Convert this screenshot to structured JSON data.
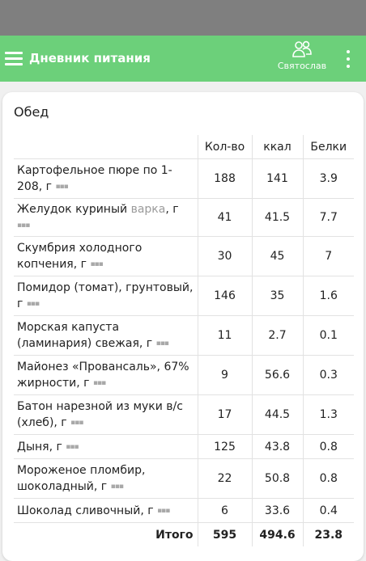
{
  "app": {
    "title": "Дневник питания",
    "user_name": "Святослав",
    "accent_color": "#6cd07a",
    "icons": {
      "menu": "hamburger-icon",
      "user": "people-icon",
      "more": "vertical-dots-icon"
    }
  },
  "meal": {
    "title": "Обед",
    "columns": [
      "Кол-во",
      "ккал",
      "Белки"
    ],
    "rows": [
      {
        "name": "Картофельное пюре по 1-208, г",
        "brand": "",
        "qty": "188",
        "kcal": "141",
        "protein": "3.9"
      },
      {
        "name": "Желудок куриный",
        "brand": "варка",
        "suffix": ", г",
        "qty": "41",
        "kcal": "41.5",
        "protein": "7.7"
      },
      {
        "name": "Скумбрия холодного копчения, г",
        "brand": "",
        "qty": "30",
        "kcal": "45",
        "protein": "7"
      },
      {
        "name": "Помидор (томат), грунтовый, г",
        "brand": "",
        "qty": "146",
        "kcal": "35",
        "protein": "1.6"
      },
      {
        "name": "Морская капуста (ламинария) свежая, г",
        "brand": "",
        "qty": "11",
        "kcal": "2.7",
        "protein": "0.1"
      },
      {
        "name": "Майонез «Провансаль», 67% жирности, г",
        "brand": "",
        "qty": "9",
        "kcal": "56.6",
        "protein": "0.3"
      },
      {
        "name": "Батон нарезной из муки в/с (хлеб), г",
        "brand": "",
        "qty": "17",
        "kcal": "44.5",
        "protein": "1.3"
      },
      {
        "name": "Дыня, г",
        "brand": "",
        "qty": "125",
        "kcal": "43.8",
        "protein": "0.8"
      },
      {
        "name": "Мороженое пломбир, шоколадный, г",
        "brand": "",
        "qty": "22",
        "kcal": "50.8",
        "protein": "0.8"
      },
      {
        "name": "Шоколад сливочный, г",
        "brand": "",
        "qty": "6",
        "kcal": "33.6",
        "protein": "0.4"
      }
    ],
    "total": {
      "label": "Итого",
      "qty": "595",
      "kcal": "494.6",
      "protein": "23.8"
    },
    "row_menu_glyph": "▪▪▪"
  }
}
